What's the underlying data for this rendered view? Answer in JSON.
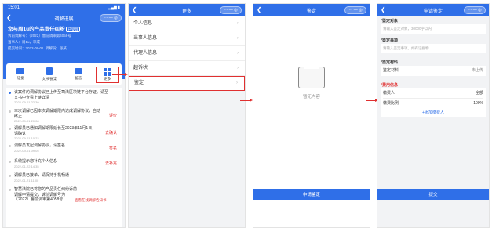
{
  "p1": {
    "time": "15:01",
    "signal": "▂▄▆ ▮",
    "title": "调解进展",
    "case_title": "您与周1u的产品责任纠纷",
    "case_tag": "已受理",
    "case_no": "诉前调解号：（2022）鲁前调审第4058号",
    "applicant": "当事人：周1u，李成",
    "submit": "提交时间：2022-09-01",
    "mediator": "调解员：张某",
    "icons": [
      {
        "label": "证据"
      },
      {
        "label": "文书/报案"
      },
      {
        "label": "留言"
      },
      {
        "label": "更多"
      }
    ],
    "timeline": [
      {
        "text": "该案件的调解协议已上传至司法区块链平台存证。请至文书中查看上链详情",
        "date": "2022-09-01 22:30",
        "action": ""
      },
      {
        "text": "本次调解已因本次调解期限内达成调解协议，自动终止",
        "date": "2022-09-01 20:08",
        "action": "评价"
      },
      {
        "text": "调解员已通知调解期限延长至2023年11月1日，请确认",
        "date": "2022-09-01 10:22",
        "action": "去确认"
      },
      {
        "text": "调解员发起调解协议，请签名",
        "date": "2022-09-01 09:05",
        "action": "签名"
      },
      {
        "text": "系统提示您补充个人信息",
        "date": "2022-01-22 14:35",
        "action": "去补充"
      },
      {
        "text": "调解员已接单，请保持手机畅通",
        "date": "2022-01-21 11:00",
        "action": ""
      },
      {
        "text": "智慧法院已将您的产品责任纠纷诉前调解申请提交，诉前调解号为（2022）鲁前调审第4058号",
        "date": "",
        "action": "查看在线调解告知书"
      }
    ]
  },
  "p2": {
    "title": "更多",
    "menu": [
      {
        "label": "个人信息"
      },
      {
        "label": "当事人信息"
      },
      {
        "label": "代理人信息"
      },
      {
        "label": "起诉状"
      },
      {
        "label": "鉴定"
      }
    ]
  },
  "p3": {
    "title": "鉴定",
    "empty_text": "暂无内容",
    "apply_button": "申请鉴定"
  },
  "p4": {
    "title": "申请鉴定",
    "sec_target": "*鉴定对象",
    "target_ph": "请输入鉴定对象，30000字以内",
    "sec_matter": "*鉴定事项",
    "matter_ph": "请输入鉴定事项，如有证据物",
    "sec_material": "*鉴定材料",
    "material_label": "鉴定材料",
    "material_value": "未上传",
    "sec_fee": "*费用信息",
    "payer_label": "缴费人",
    "payer_value": "全额",
    "ratio_label": "缴费比例",
    "ratio_value": "100%",
    "add_payer": "+添加缴费人",
    "submit_button": "提交"
  },
  "capsule": "···  —  ◎",
  "colors": {
    "brand": "#2f6fe8",
    "warn": "#e03030"
  }
}
